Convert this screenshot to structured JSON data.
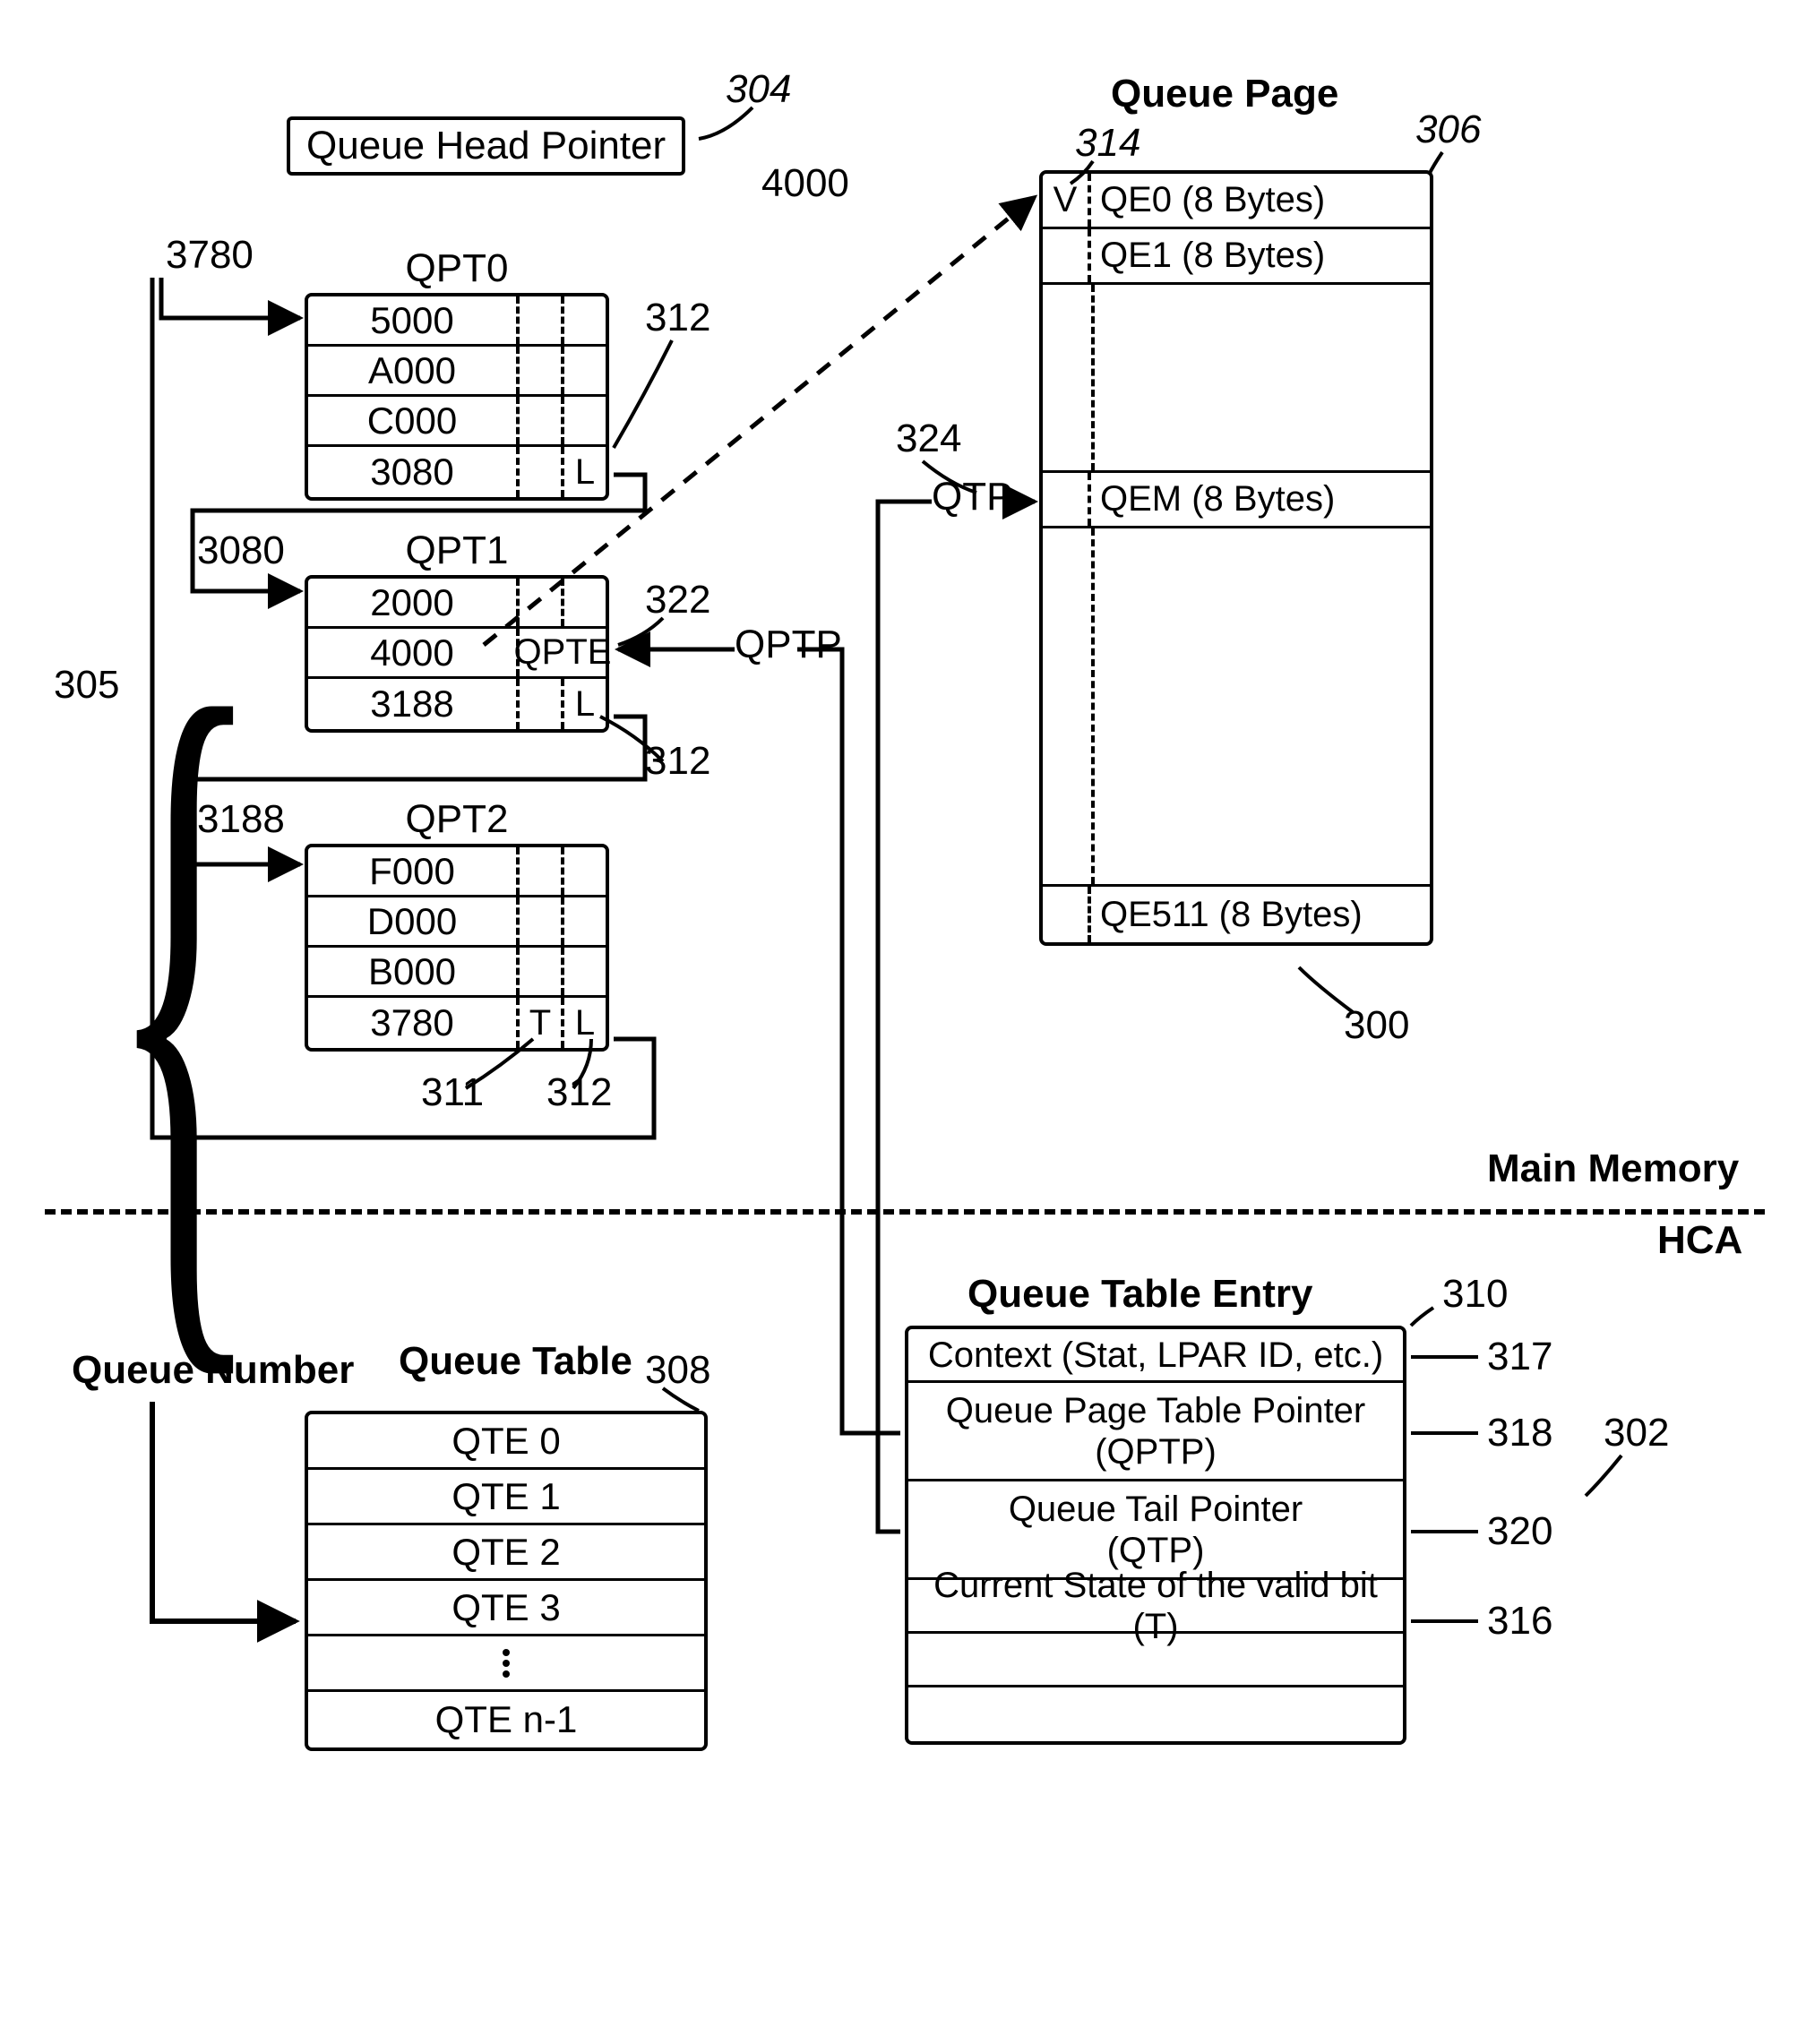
{
  "refs": {
    "r304": "304",
    "r306": "306",
    "r314": "314",
    "r312a": "312",
    "r312b": "312",
    "r312c": "312",
    "r305": "305",
    "r322": "322",
    "r324": "324",
    "r311": "311",
    "r300": "300",
    "r308": "308",
    "r310": "310",
    "r317": "317",
    "r318": "318",
    "r302": "302",
    "r320": "320",
    "r316": "316",
    "addr3780a": "3780",
    "addr3080": "3080",
    "addr3188": "3188",
    "addr4000": "4000"
  },
  "headPointer": "Queue Head Pointer",
  "queuePageTitle": "Queue Page",
  "mainMemory": "Main Memory",
  "hca": "HCA",
  "queueNumber": "Queue Number",
  "queueTableLabel": "Queue Table",
  "qteTitle": "Queue Table Entry",
  "qptp": "QPTP",
  "qtp": "QTP",
  "qpte": "QPTE",
  "qpt0": {
    "name": "QPT0",
    "rows": [
      "5000",
      "A000",
      "C000",
      "3080"
    ]
  },
  "qpt1": {
    "name": "QPT1",
    "rows": [
      "2000",
      "4000",
      "3188"
    ]
  },
  "qpt2": {
    "name": "QPT2",
    "rows": [
      "F000",
      "D000",
      "B000",
      "3780"
    ]
  },
  "queuePage": {
    "v": "V",
    "qe0": "QE0 (8 Bytes)",
    "qe1": "QE1 (8 Bytes)",
    "qem": "QEM (8 Bytes)",
    "qe511": "QE511 (8 Bytes)"
  },
  "queueTable": {
    "rows": [
      "QTE 0",
      "QTE 1",
      "QTE 2",
      "QTE 3",
      "",
      "QTE  n-1"
    ]
  },
  "qte": {
    "row1": "Context (Stat, LPAR ID, etc.)",
    "row2a": "Queue Page Table Pointer",
    "row2b": "(QPTP)",
    "row3a": "Queue Tail Pointer",
    "row3b": "(QTP)",
    "row4": "Current State of the valid bit (T)"
  },
  "flags": {
    "L": "L",
    "T": "T"
  }
}
